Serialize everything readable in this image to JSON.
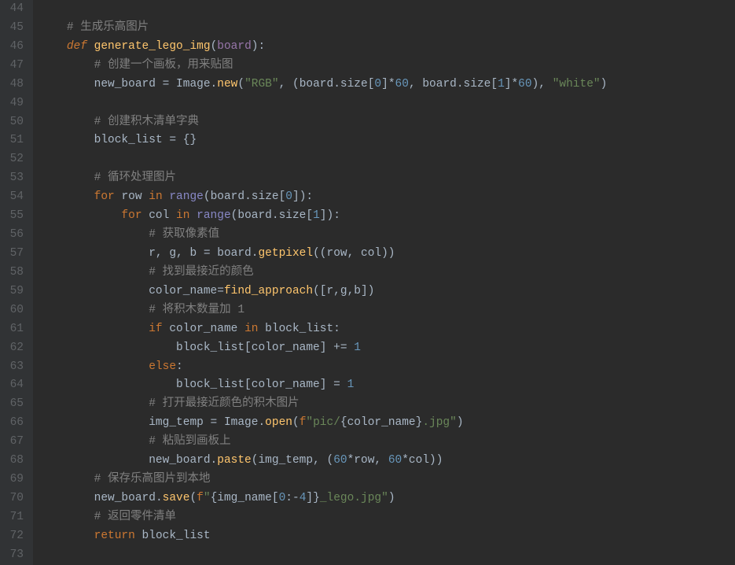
{
  "gutter": {
    "start": 44,
    "end": 73
  },
  "lines": {
    "44": {
      "tokens": []
    },
    "45": {
      "indent": 1,
      "tokens": [
        {
          "t": "c",
          "v": "# 生成乐高图片"
        }
      ]
    },
    "46": {
      "indent": 1,
      "tokens": [
        {
          "t": "kd",
          "v": "def "
        },
        {
          "t": "fn",
          "v": "generate_lego_img"
        },
        {
          "t": "op",
          "v": "("
        },
        {
          "t": "pc",
          "v": "board"
        },
        {
          "t": "op",
          "v": "):"
        }
      ]
    },
    "47": {
      "indent": 2,
      "tokens": [
        {
          "t": "c",
          "v": "# 创建一个画板，用来贴图"
        }
      ]
    },
    "48": {
      "indent": 2,
      "tokens": [
        {
          "t": "id",
          "v": "new_board = Image."
        },
        {
          "t": "m",
          "v": "new"
        },
        {
          "t": "op",
          "v": "("
        },
        {
          "t": "s",
          "v": "\"RGB\""
        },
        {
          "t": "op",
          "v": ", (board.size["
        },
        {
          "t": "n",
          "v": "0"
        },
        {
          "t": "op",
          "v": "]*"
        },
        {
          "t": "n",
          "v": "60"
        },
        {
          "t": "op",
          "v": ", board.size["
        },
        {
          "t": "n",
          "v": "1"
        },
        {
          "t": "op",
          "v": "]*"
        },
        {
          "t": "n",
          "v": "60"
        },
        {
          "t": "op",
          "v": "), "
        },
        {
          "t": "s",
          "v": "\"white\""
        },
        {
          "t": "op",
          "v": ")"
        }
      ]
    },
    "49": {
      "tokens": []
    },
    "50": {
      "indent": 2,
      "tokens": [
        {
          "t": "c",
          "v": "# 创建积木清单字典"
        }
      ]
    },
    "51": {
      "indent": 2,
      "tokens": [
        {
          "t": "id",
          "v": "block_list = {}"
        }
      ]
    },
    "52": {
      "tokens": []
    },
    "53": {
      "indent": 2,
      "tokens": [
        {
          "t": "c",
          "v": "# 循环处理图片"
        }
      ]
    },
    "54": {
      "indent": 2,
      "tokens": [
        {
          "t": "k",
          "v": "for "
        },
        {
          "t": "id",
          "v": "row "
        },
        {
          "t": "k",
          "v": "in "
        },
        {
          "t": "bi",
          "v": "range"
        },
        {
          "t": "op",
          "v": "(board.size["
        },
        {
          "t": "n",
          "v": "0"
        },
        {
          "t": "op",
          "v": "]):"
        }
      ]
    },
    "55": {
      "indent": 3,
      "tokens": [
        {
          "t": "k",
          "v": "for "
        },
        {
          "t": "id",
          "v": "col "
        },
        {
          "t": "k",
          "v": "in "
        },
        {
          "t": "bi",
          "v": "range"
        },
        {
          "t": "op",
          "v": "(board.size["
        },
        {
          "t": "n",
          "v": "1"
        },
        {
          "t": "op",
          "v": "]):"
        }
      ]
    },
    "56": {
      "indent": 4,
      "tokens": [
        {
          "t": "c",
          "v": "# 获取像素值"
        }
      ]
    },
    "57": {
      "indent": 4,
      "tokens": [
        {
          "t": "id",
          "v": "r, g, b = board."
        },
        {
          "t": "m",
          "v": "getpixel"
        },
        {
          "t": "op",
          "v": "((row, col))"
        }
      ]
    },
    "58": {
      "indent": 4,
      "tokens": [
        {
          "t": "c",
          "v": "# 找到最接近的颜色"
        }
      ]
    },
    "59": {
      "indent": 4,
      "tokens": [
        {
          "t": "id",
          "v": "color_name="
        },
        {
          "t": "m",
          "v": "find_approach"
        },
        {
          "t": "op",
          "v": "([r,g,b])"
        }
      ]
    },
    "60": {
      "indent": 4,
      "tokens": [
        {
          "t": "c",
          "v": "# 将积木数量加 1"
        }
      ]
    },
    "61": {
      "indent": 4,
      "tokens": [
        {
          "t": "k",
          "v": "if "
        },
        {
          "t": "id",
          "v": "color_name "
        },
        {
          "t": "k",
          "v": "in "
        },
        {
          "t": "id",
          "v": "block_list:"
        }
      ]
    },
    "62": {
      "indent": 5,
      "tokens": [
        {
          "t": "id",
          "v": "block_list[color_name] += "
        },
        {
          "t": "n",
          "v": "1"
        }
      ]
    },
    "63": {
      "indent": 4,
      "tokens": [
        {
          "t": "k",
          "v": "else"
        },
        {
          "t": "op",
          "v": ":"
        }
      ]
    },
    "64": {
      "indent": 5,
      "tokens": [
        {
          "t": "id",
          "v": "block_list[color_name] = "
        },
        {
          "t": "n",
          "v": "1"
        }
      ]
    },
    "65": {
      "indent": 4,
      "tokens": [
        {
          "t": "c",
          "v": "# 打开最接近颜色的积木图片"
        }
      ]
    },
    "66": {
      "indent": 4,
      "tokens": [
        {
          "t": "id",
          "v": "img_temp = Image."
        },
        {
          "t": "m",
          "v": "open"
        },
        {
          "t": "op",
          "v": "("
        },
        {
          "t": "sp",
          "v": "f"
        },
        {
          "t": "s",
          "v": "\"pic/"
        },
        {
          "t": "br",
          "v": "{"
        },
        {
          "t": "fval",
          "v": "color_name"
        },
        {
          "t": "br",
          "v": "}"
        },
        {
          "t": "s",
          "v": ".jpg\""
        },
        {
          "t": "op",
          "v": ")"
        }
      ]
    },
    "67": {
      "indent": 4,
      "tokens": [
        {
          "t": "c",
          "v": "# 粘贴到画板上"
        }
      ]
    },
    "68": {
      "indent": 4,
      "tokens": [
        {
          "t": "id",
          "v": "new_board."
        },
        {
          "t": "m",
          "v": "paste"
        },
        {
          "t": "op",
          "v": "(img_temp, ("
        },
        {
          "t": "n",
          "v": "60"
        },
        {
          "t": "op",
          "v": "*row, "
        },
        {
          "t": "n",
          "v": "60"
        },
        {
          "t": "op",
          "v": "*col))"
        }
      ]
    },
    "69": {
      "indent": 2,
      "tokens": [
        {
          "t": "c",
          "v": "# 保存乐高图片到本地"
        }
      ]
    },
    "70": {
      "indent": 2,
      "tokens": [
        {
          "t": "id",
          "v": "new_board."
        },
        {
          "t": "m",
          "v": "save"
        },
        {
          "t": "op",
          "v": "("
        },
        {
          "t": "sp",
          "v": "f"
        },
        {
          "t": "s",
          "v": "\""
        },
        {
          "t": "br",
          "v": "{"
        },
        {
          "t": "fval",
          "v": "img_name["
        },
        {
          "t": "n",
          "v": "0"
        },
        {
          "t": "fval",
          "v": ":-"
        },
        {
          "t": "n",
          "v": "4"
        },
        {
          "t": "fval",
          "v": "]"
        },
        {
          "t": "br",
          "v": "}"
        },
        {
          "t": "s",
          "v": "_lego.jpg\""
        },
        {
          "t": "op",
          "v": ")"
        }
      ]
    },
    "71": {
      "indent": 2,
      "tokens": [
        {
          "t": "c",
          "v": "# 返回零件清单"
        }
      ]
    },
    "72": {
      "indent": 2,
      "tokens": [
        {
          "t": "k",
          "v": "return "
        },
        {
          "t": "id",
          "v": "block_list"
        }
      ]
    },
    "73": {
      "tokens": []
    }
  }
}
